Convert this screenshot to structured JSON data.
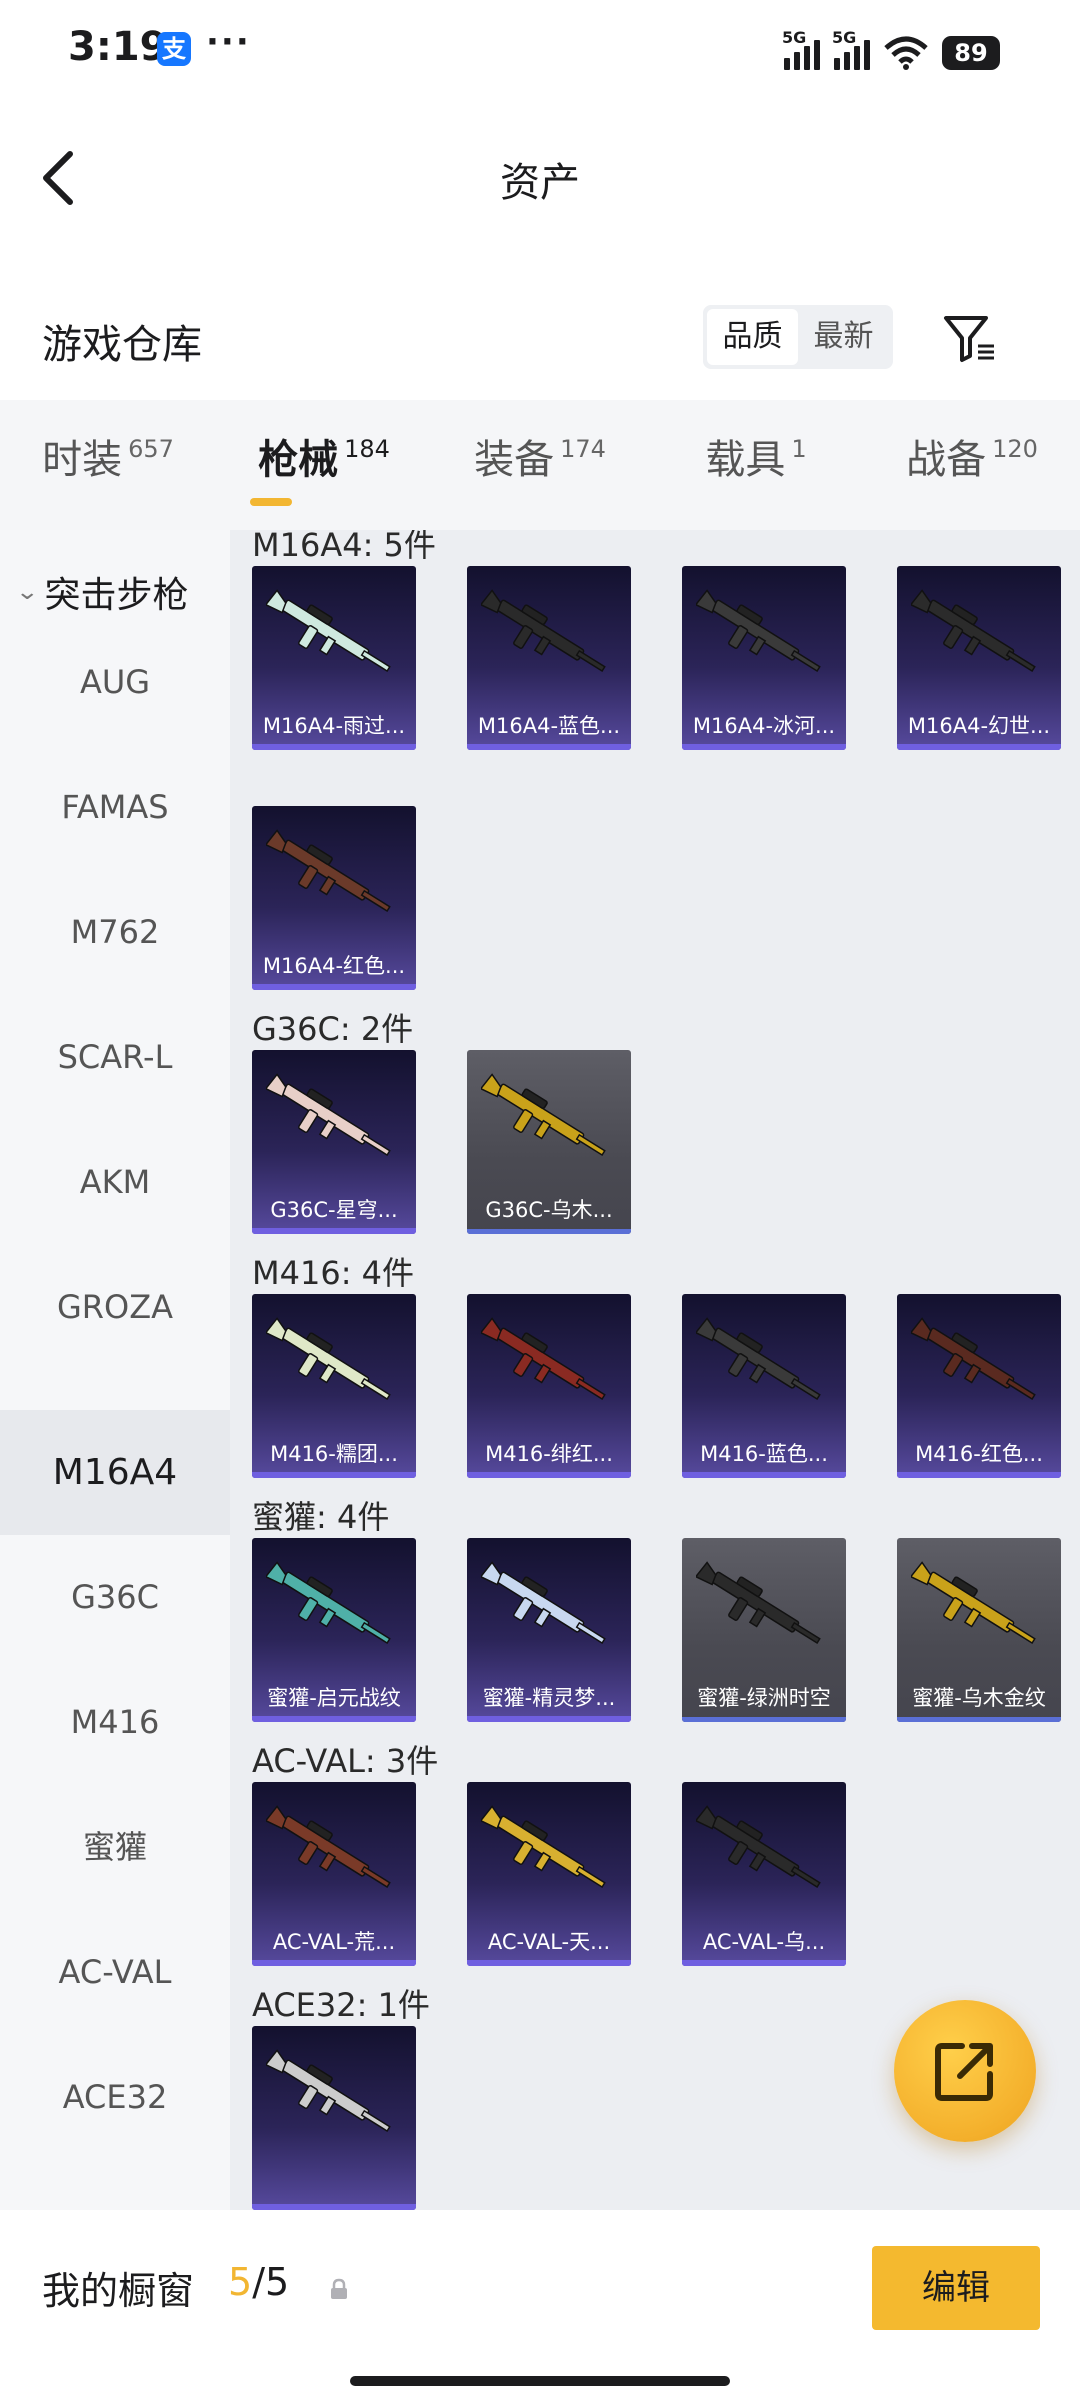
{
  "status_bar": {
    "time": "3:19",
    "alipay_glyph": "支",
    "more": "···",
    "sim1": "5G",
    "sim2": "5G",
    "battery": "89"
  },
  "header": {
    "title": "资产"
  },
  "section": {
    "title": "游戏仓库",
    "sort_options": [
      "品质",
      "最新"
    ]
  },
  "tabs": [
    {
      "label": "时装",
      "count": "657"
    },
    {
      "label": "枪械",
      "count": "184",
      "active": true
    },
    {
      "label": "装备",
      "count": "174"
    },
    {
      "label": "载具",
      "count": "1"
    },
    {
      "label": "战备",
      "count": "120"
    }
  ],
  "sidebar": {
    "category": "突击步枪",
    "items": [
      "AUG",
      "FAMAS",
      "M762",
      "SCAR-L",
      "AKM",
      "GROZA",
      "M16A4",
      "G36C",
      "M416",
      "蜜獾",
      "AC-VAL",
      "ACE32"
    ],
    "active": "M16A4"
  },
  "groups": [
    {
      "title": "M16A4: 5件",
      "items": [
        {
          "name": "M16A4-雨过...",
          "style": "purple"
        },
        {
          "name": "M16A4-蓝色...",
          "style": "purple"
        },
        {
          "name": "M16A4-冰河...",
          "style": "purple"
        },
        {
          "name": "M16A4-幻世...",
          "style": "purple"
        },
        {
          "name": "M16A4-红色...",
          "style": "purple"
        }
      ]
    },
    {
      "title": "G36C: 2件",
      "items": [
        {
          "name": "G36C-星穹...",
          "style": "purple"
        },
        {
          "name": "G36C-乌木...",
          "style": "grey"
        }
      ]
    },
    {
      "title": "M416: 4件",
      "items": [
        {
          "name": "M416-糯团...",
          "style": "purple"
        },
        {
          "name": "M416-绯红...",
          "style": "purple"
        },
        {
          "name": "M416-蓝色...",
          "style": "purple"
        },
        {
          "name": "M416-红色...",
          "style": "purple"
        }
      ]
    },
    {
      "title": "蜜獾: 4件",
      "items": [
        {
          "name": "蜜獾-启元战纹",
          "style": "purple"
        },
        {
          "name": "蜜獾-精灵梦...",
          "style": "purple"
        },
        {
          "name": "蜜獾-绿洲时空",
          "style": "grey"
        },
        {
          "name": "蜜獾-乌木金纹",
          "style": "grey"
        }
      ]
    },
    {
      "title": "AC-VAL: 3件",
      "items": [
        {
          "name": "AC-VAL-荒...",
          "style": "purple"
        },
        {
          "name": "AC-VAL-天...",
          "style": "purple"
        },
        {
          "name": "AC-VAL-乌...",
          "style": "purple"
        }
      ]
    },
    {
      "title": "ACE32: 1件",
      "items": [
        {
          "name": "",
          "style": "purple"
        }
      ]
    }
  ],
  "fab": {
    "icon": "share-external-icon"
  },
  "bottom_bar": {
    "label": "我的橱窗",
    "current": "5",
    "total": "/5",
    "edit_label": "编辑"
  },
  "colors": {
    "accent": "#f4b92f",
    "card_top": "#13112e",
    "card_bottom": "#574a9e"
  }
}
